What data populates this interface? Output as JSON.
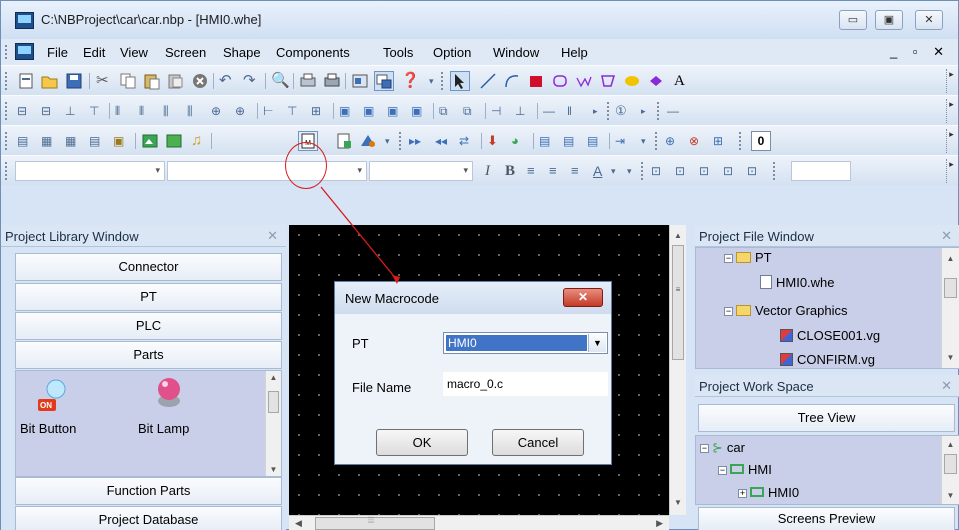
{
  "window": {
    "title": "C:\\NBProject\\car\\car.nbp - [HMI0.whe]",
    "controls": {
      "minimize": "▭",
      "maximize": "▣",
      "close": "✕"
    }
  },
  "menubar": {
    "items": [
      {
        "label": "File"
      },
      {
        "label": "Edit"
      },
      {
        "label": "View"
      },
      {
        "label": "Screen"
      },
      {
        "label": "Shape"
      },
      {
        "label": "Components"
      },
      {
        "label": "Tools"
      },
      {
        "label": "Option"
      },
      {
        "label": "Window"
      },
      {
        "label": "Help"
      }
    ],
    "mdi_controls": "_ ▫ ✕"
  },
  "toolbar4": {
    "value_box": "0"
  },
  "format_toolbar": {
    "italic": "I",
    "bold": "B",
    "font_color": "A"
  },
  "project_library": {
    "title": "Project Library Window",
    "buttons": {
      "connector": "Connector",
      "pt": "PT",
      "plc": "PLC",
      "parts": "Parts",
      "function_parts": "Function Parts",
      "project_database": "Project Database"
    },
    "parts": [
      {
        "label": "Bit Button",
        "badge": "ON"
      },
      {
        "label": "Bit Lamp"
      }
    ]
  },
  "project_file_window": {
    "title": "Project File Window",
    "tree": [
      {
        "label": "PT"
      },
      {
        "label": "HMI0.whe"
      },
      {
        "label": "Vector Graphics"
      },
      {
        "label": "CLOSE001.vg"
      },
      {
        "label": "CONFIRM.vg"
      }
    ]
  },
  "project_work_space": {
    "title": "Project Work Space",
    "tree_view_button": "Tree View",
    "tree": [
      {
        "label": "car"
      },
      {
        "label": "HMI"
      },
      {
        "label": "HMI0"
      }
    ],
    "screens_preview_button": "Screens Preview"
  },
  "dialog": {
    "title": "New Macrocode",
    "close_label": "✕",
    "pt_label": "PT",
    "pt_value": "HMI0",
    "file_name_label": "File Name",
    "file_name_value": "macro_0.c",
    "ok_label": "OK",
    "cancel_label": "Cancel"
  },
  "colors": {
    "highlight": "#3f74c7",
    "callout": "#d81b1b",
    "panel_bg": "#c9cfe8"
  }
}
